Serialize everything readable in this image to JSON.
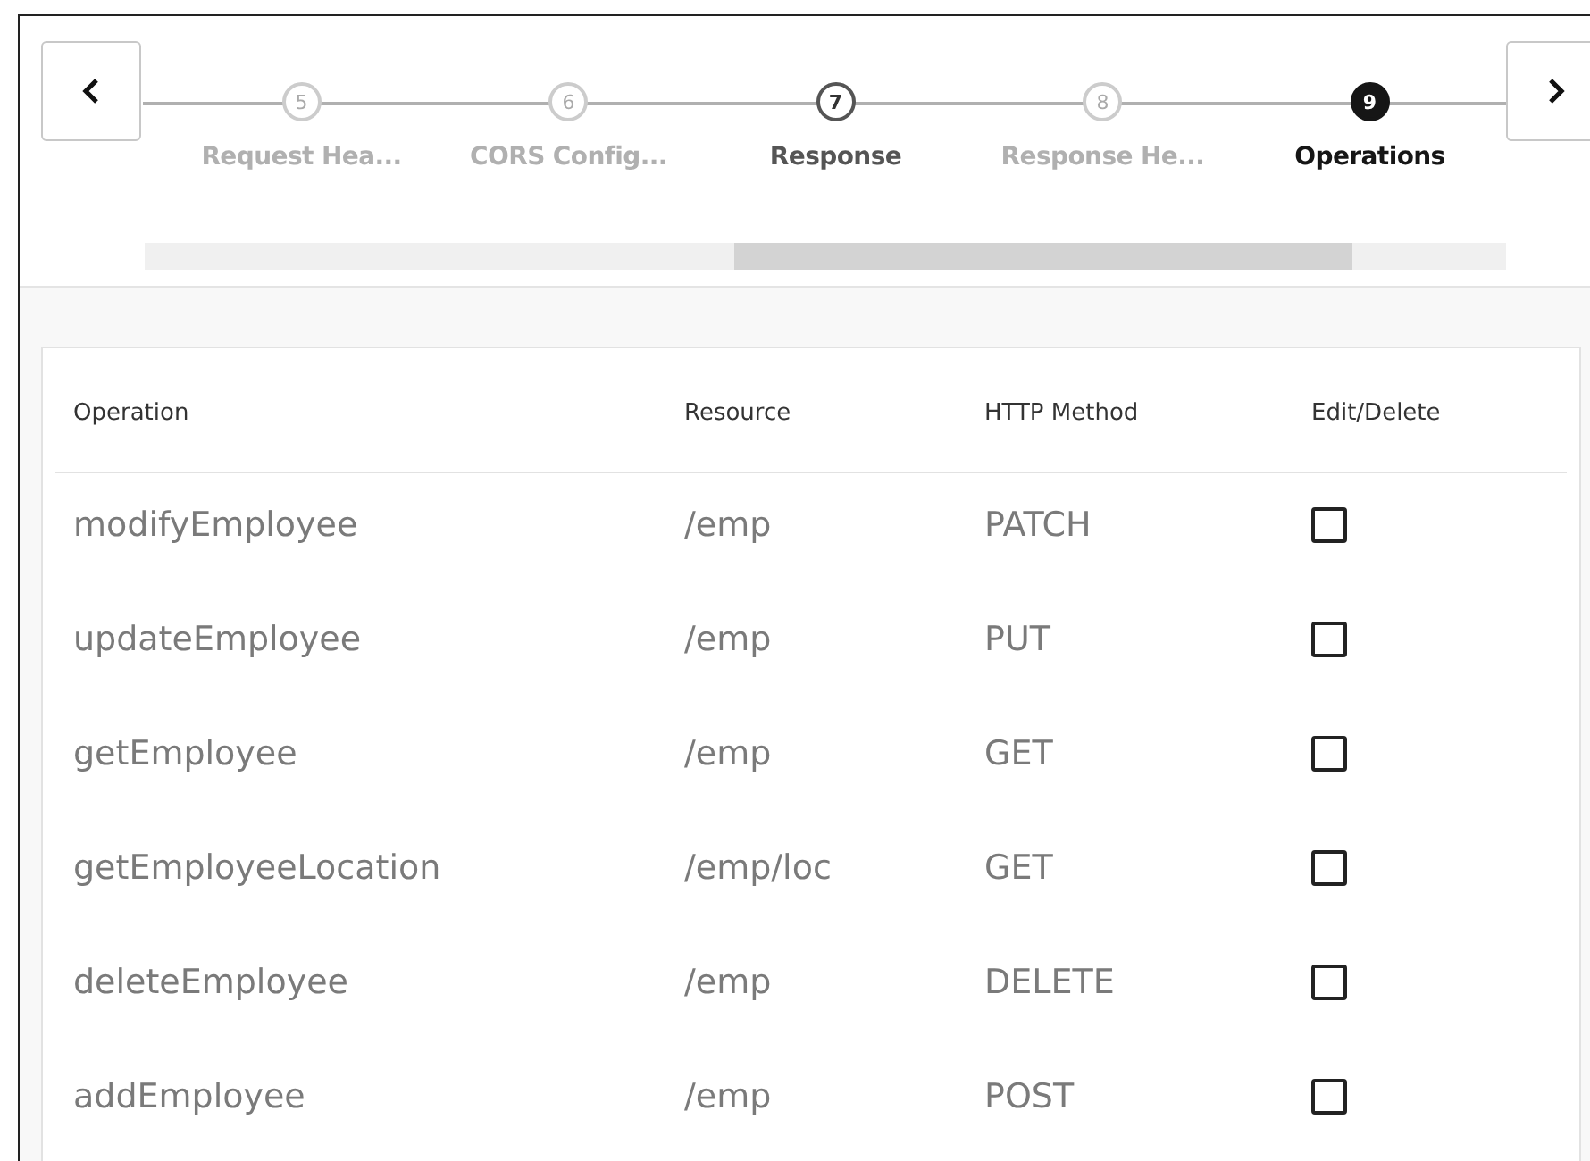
{
  "train": {
    "steps": [
      {
        "number": "5",
        "label": "Request Hea...",
        "visited": false,
        "selected": false
      },
      {
        "number": "6",
        "label": "CORS Config...",
        "visited": false,
        "selected": false
      },
      {
        "number": "7",
        "label": "Response",
        "visited": true,
        "selected": false
      },
      {
        "number": "8",
        "label": "Response He...",
        "visited": false,
        "selected": false
      },
      {
        "number": "9",
        "label": "Operations",
        "visited": false,
        "selected": true
      }
    ]
  },
  "table": {
    "columns": [
      "Operation",
      "Resource",
      "HTTP Method",
      "Edit/Delete"
    ],
    "rows": [
      {
        "operation": "modifyEmployee",
        "resource": "/emp",
        "method": "PATCH",
        "checked": false
      },
      {
        "operation": "updateEmployee",
        "resource": "/emp",
        "method": "PUT",
        "checked": false
      },
      {
        "operation": "getEmployee",
        "resource": "/emp",
        "method": "GET",
        "checked": false
      },
      {
        "operation": "getEmployeeLocation",
        "resource": "/emp/loc",
        "method": "GET",
        "checked": false
      },
      {
        "operation": "deleteEmployee",
        "resource": "/emp",
        "method": "DELETE",
        "checked": false
      },
      {
        "operation": "addEmployee",
        "resource": "/emp",
        "method": "POST",
        "checked": false
      }
    ]
  }
}
